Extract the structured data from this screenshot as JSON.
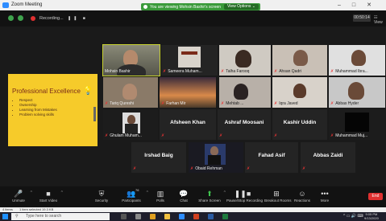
{
  "window": {
    "title": "Zoom Meeting"
  },
  "share_banner": {
    "message": "You are viewing Mohsin Bashir's screen",
    "view_options": "View Options ⌄"
  },
  "top": {
    "recording": "Recording...",
    "pause_stop": "❚❚ ■",
    "timer": "00:50:14",
    "view": "☷ View"
  },
  "slide": {
    "title": "Professional Excellence",
    "bullets": [
      "Respect",
      "Ownership",
      "Learning from Mistakes",
      "Problem solving skills"
    ]
  },
  "participants": {
    "mohsin": "Mohsin Bashir",
    "sameera": "Sameera Muham...",
    "talha": "Talha Farooq",
    "ahsan": "Ahsan Qadri",
    "ibrahim": "Muhammad Ibra...",
    "tariq": "Tariq Qureshi",
    "farhan": "Farhan Mir",
    "mehtab": "Mehtab ...",
    "iqra": "Iqra Javed",
    "abbas_hyder": "Abbas Hyder",
    "ghulam": "Ghulam Muham...",
    "afsheen": "Afsheen Khan",
    "ashraf": "Ashraf Moosani",
    "kashir": "Kashir Uddin",
    "mujtaba": "Muhammad Muj...",
    "irshad": "Irshad Baig",
    "obaid": "Obaid Rehman",
    "fahad": "Fahad Asif",
    "abbas_zaidi": "Abbas Zaidi"
  },
  "toolbar": {
    "unmute": "Unmute",
    "start_video": "Start Video",
    "security": "Security",
    "participants": "Participants",
    "participants_count": "76",
    "polls": "Polls",
    "chat": "Chat",
    "share_screen": "Share Screen",
    "recording": "Pause/Stop Recording",
    "breakout": "Breakout Rooms",
    "reactions": "Reactions",
    "more": "More",
    "end": "End"
  },
  "statusbar": {
    "items": "4 items",
    "selected": "1 item selected 19.3 KB"
  },
  "taskbar": {
    "search_placeholder": "Type here to search",
    "time": "9:05 PM",
    "date": "9/13/2020"
  },
  "colors": {
    "slide_bg": "#f6cb2a",
    "active_speaker": "#c9d32f",
    "end_button": "#e03030",
    "share_banner": "#3a9a3a"
  },
  "icons": [
    "zoom-logo-icon",
    "microphone-icon",
    "video-icon",
    "shield-icon",
    "participants-icon",
    "polls-icon",
    "chat-icon",
    "share-screen-icon",
    "record-icon",
    "breakout-icon",
    "reactions-icon",
    "more-icon",
    "windows-icon",
    "search-icon",
    "lightbulb-icon"
  ]
}
